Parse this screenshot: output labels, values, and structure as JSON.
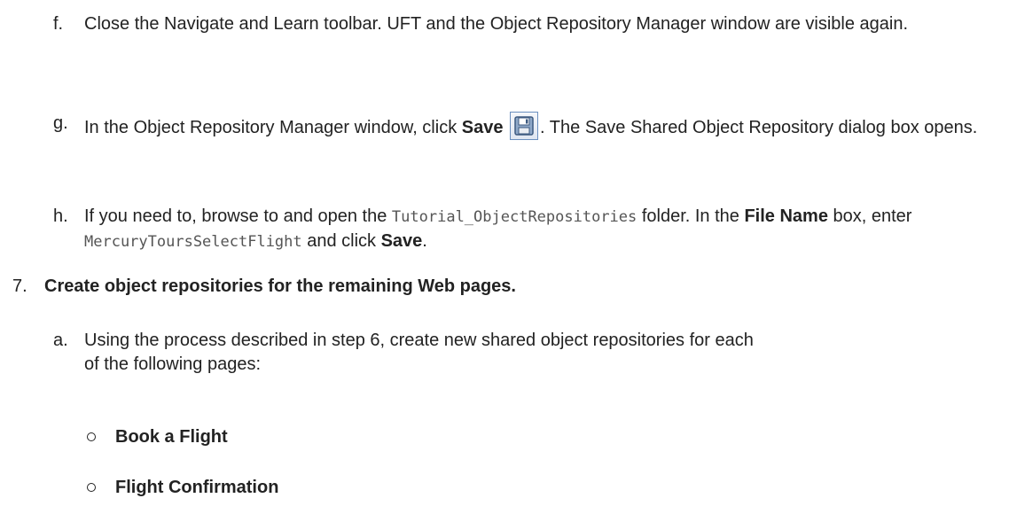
{
  "steps": {
    "f": {
      "marker": "f.",
      "text": "Close the Navigate and Learn toolbar. UFT and the Object Repository Manager window are visible again."
    },
    "g": {
      "marker": "g.",
      "text_before": "In the Object Repository Manager window, click ",
      "save_bold": "Save",
      "text_after": ". The Save Shared Object Repository dialog box opens.",
      "icon": "floppy-disk-save-icon"
    },
    "h": {
      "marker": "h.",
      "text_1": "If you need to, browse to and open the ",
      "folder_code": "Tutorial_ObjectRepositories",
      "text_2": " folder. In the ",
      "file_name_bold": "File Name",
      "text_3": " box, enter ",
      "filename_code": "MercuryToursSelectFlight",
      "text_4": " and click ",
      "save_bold": "Save",
      "text_5": "."
    },
    "seven": {
      "marker": "7.",
      "title": "Create object repositories for the remaining Web pages."
    },
    "seven_a": {
      "marker": "a.",
      "text": "Using the process described in step 6, create new shared object repositories for each of the following pages:"
    }
  },
  "pages": [
    "Book a Flight",
    "Flight Confirmation"
  ]
}
